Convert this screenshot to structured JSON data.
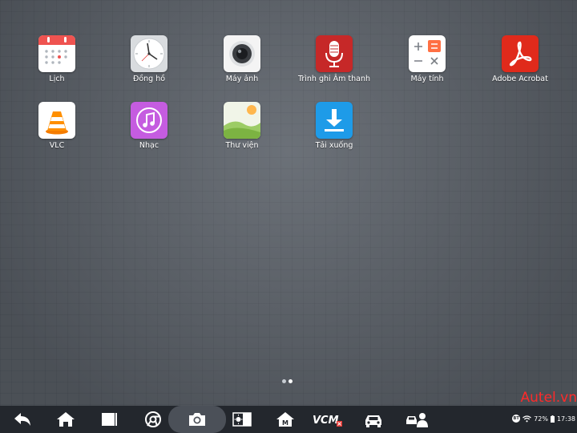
{
  "apps": [
    {
      "label": "Lịch",
      "icon": "calendar-icon"
    },
    {
      "label": "Đồng hồ",
      "icon": "clock-icon"
    },
    {
      "label": "Máy ảnh",
      "icon": "camera-lens-icon"
    },
    {
      "label": "Trình ghi Âm thanh",
      "icon": "microphone-icon"
    },
    {
      "label": "Máy tính",
      "icon": "calculator-icon"
    },
    {
      "label": "Adobe Acrobat",
      "icon": "acrobat-icon"
    },
    {
      "label": "VLC",
      "icon": "vlc-cone-icon"
    },
    {
      "label": "Nhạc",
      "icon": "music-note-icon"
    },
    {
      "label": "Thư viện",
      "icon": "gallery-icon"
    },
    {
      "label": "Tải xuống",
      "icon": "download-icon"
    }
  ],
  "page_indicator": {
    "total": 2,
    "current": 2
  },
  "navbar": {
    "buttons": [
      "back-icon",
      "home-icon",
      "recent-apps-icon",
      "chrome-icon",
      "screenshot-camera-icon",
      "brightness-icon",
      "maintenance-home-icon",
      "vcmi-icon",
      "car-icon",
      "technician-icon"
    ],
    "vcm_label": "VCM",
    "m_label": "M"
  },
  "watermark": "Autel.vn",
  "status": {
    "bt": "BT",
    "battery": "72%",
    "time": "17:38"
  },
  "colors": {
    "calendar_red": "#ef5350",
    "mic_red": "#c62828",
    "calc_orange": "#ff7043",
    "acrobat_red": "#e02a1b",
    "music_purple": "#c55ce0",
    "download_blue": "#1e9be8",
    "watermark_red": "#ff2a2a"
  }
}
